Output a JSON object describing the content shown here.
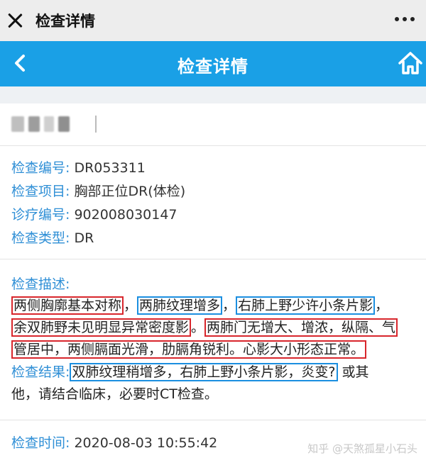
{
  "wechat_bar": {
    "title": "检查详情"
  },
  "header": {
    "title": "检查详情"
  },
  "fields": [
    {
      "label": "检查编号:",
      "value": "DR053311"
    },
    {
      "label": "检查项目:",
      "value": "胸部正位DR(体检)"
    },
    {
      "label": "诊疗编号:",
      "value": "902008030147"
    },
    {
      "label": "检查类型:",
      "value": "DR"
    }
  ],
  "description": {
    "label": "检查描述:",
    "seg1": "两侧胸廓基本对称",
    "sep1": "，",
    "seg2": "两肺纹理增多",
    "sep2": "，",
    "seg3": "右肺上野少许小条片影",
    "sep3": "，",
    "seg4": "余双肺野未见明显异常密度影",
    "sep4": "。",
    "seg5a": "两肺门无增大、增浓，纵隔、气",
    "seg5b": "管居中，两侧膈面光滑，肋膈角锐利。心影大小形态正常。"
  },
  "result": {
    "label": "检查结果:",
    "highlight": "双肺纹理稍增多，右肺上野小条片影，炎变?",
    "rest_line1": " 或其",
    "line2": "他，请结合临床，必要时CT检查。"
  },
  "time": {
    "label": "检查时间:",
    "value": "2020-08-03 10:55:42"
  },
  "watermark": "知乎 @天煞孤星小石头",
  "colors": {
    "accent": "#1aa0e6",
    "label": "#2f8fd6",
    "red_box": "#d8262c",
    "blue_box": "#1b8fe0"
  }
}
